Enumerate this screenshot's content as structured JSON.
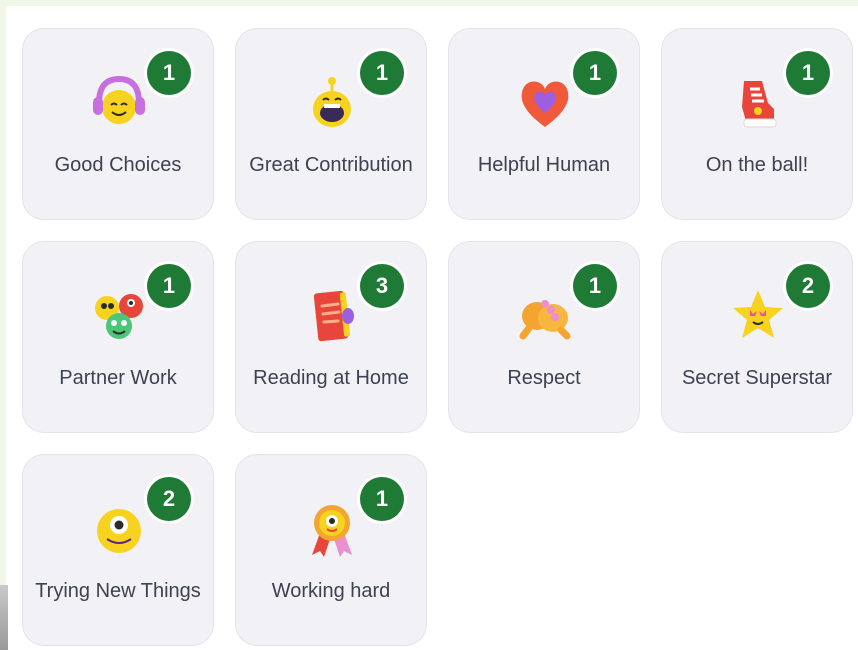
{
  "skills": [
    {
      "label": "Good Choices",
      "count": "1",
      "icon": "headphones-smiley-icon"
    },
    {
      "label": "Great Contribution",
      "count": "1",
      "icon": "cheering-monster-icon"
    },
    {
      "label": "Helpful Human",
      "count": "1",
      "icon": "heart-icon"
    },
    {
      "label": "On the ball!",
      "count": "1",
      "icon": "sneaker-icon"
    },
    {
      "label": "Partner Work",
      "count": "1",
      "icon": "monster-group-icon"
    },
    {
      "label": "Reading at Home",
      "count": "3",
      "icon": "book-icon"
    },
    {
      "label": "Respect",
      "count": "1",
      "icon": "fist-bump-icon"
    },
    {
      "label": "Secret Superstar",
      "count": "2",
      "icon": "star-sunglasses-icon"
    },
    {
      "label": "Trying New Things",
      "count": "2",
      "icon": "one-eyed-monster-icon"
    },
    {
      "label": "Working hard",
      "count": "1",
      "icon": "award-ribbon-icon"
    }
  ],
  "colors": {
    "badge": "#1f7a35",
    "card": "#f1f1f6",
    "text": "#3d4250"
  }
}
